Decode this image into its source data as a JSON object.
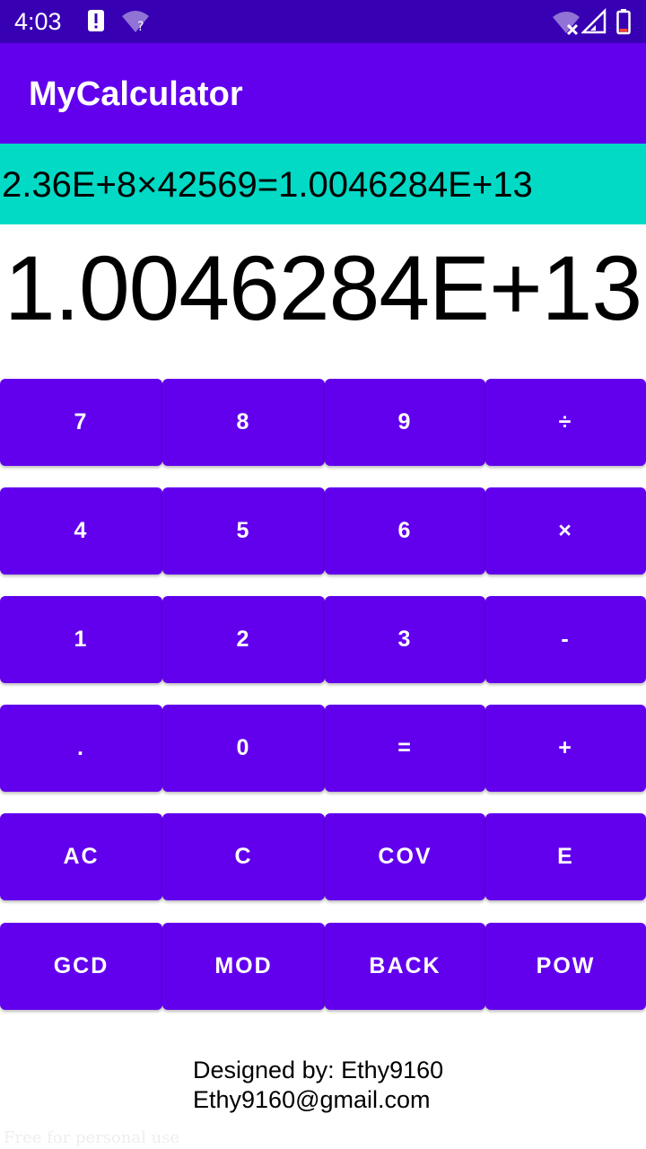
{
  "status_bar": {
    "time": "4:03",
    "icons": [
      "alert-icon",
      "wifi-unknown-icon",
      "wifi-off-icon",
      "signal-icon",
      "battery-low-icon"
    ]
  },
  "app_bar": {
    "title": "MyCalculator"
  },
  "display": {
    "expression": "2.36E+8×42569=1.0046284E+13",
    "result": "1.0046284E+13"
  },
  "keypad": {
    "rows": [
      [
        "7",
        "8",
        "9",
        "÷"
      ],
      [
        "4",
        "5",
        "6",
        "×"
      ],
      [
        "1",
        "2",
        "3",
        "-"
      ],
      [
        ".",
        "0",
        "=",
        "+"
      ],
      [
        "AC",
        "C",
        "COV",
        "E"
      ],
      [
        "GCD",
        "MOD",
        "BACK",
        "POW"
      ]
    ]
  },
  "footer": {
    "designer": "Designed by: Ethy9160",
    "email": "Ethy9160@gmail.com",
    "watermark": "Free for personal use"
  },
  "colors": {
    "status_bar": "#3700b3",
    "primary": "#6200ee",
    "display_bg": "#03dac5",
    "text_on_primary": "#ffffff"
  }
}
